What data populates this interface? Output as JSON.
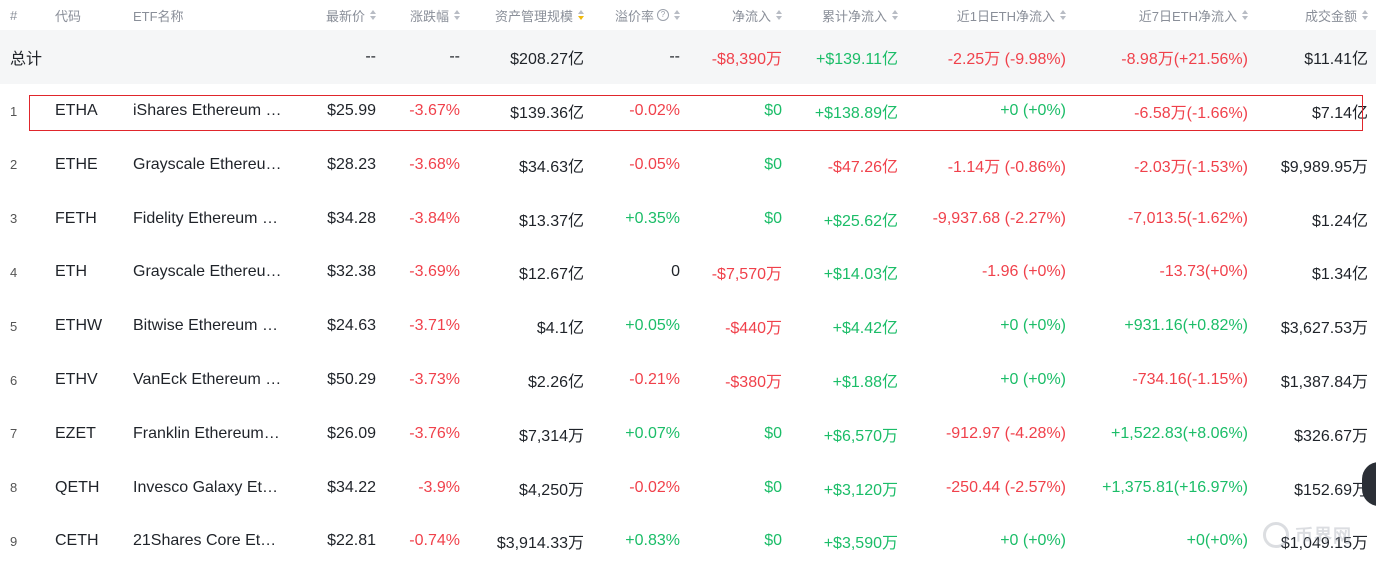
{
  "headers": {
    "idx": "#",
    "code": "代码",
    "name": "ETF名称",
    "price": "最新价",
    "change": "涨跌幅",
    "aum": "资产管理规模",
    "premium": "溢价率",
    "netflow": "净流入",
    "cumflow": "累计净流入",
    "eth1d": "近1日ETH净流入",
    "eth7d": "近7日ETH净流入",
    "volume": "成交金额"
  },
  "total": {
    "label": "总计",
    "price": "--",
    "change": "--",
    "aum": "$208.27亿",
    "premium": "--",
    "netflow": "-$8,390万",
    "cumflow": "+$139.11亿",
    "eth1d": "-2.25万 (-9.98%)",
    "eth7d": "-8.98万(+21.56%)",
    "volume": "$11.41亿"
  },
  "rows": [
    {
      "idx": "1",
      "code": "ETHA",
      "name": "iShares Ethereum …",
      "price": "$25.99",
      "change": "-3.67%",
      "aum": "$139.36亿",
      "premium": "-0.02%",
      "netflow": "$0",
      "cumflow": "+$138.89亿",
      "eth1d": "+0 (+0%)",
      "eth7d": "-6.58万(-1.66%)",
      "volume": "$7.14亿"
    },
    {
      "idx": "2",
      "code": "ETHE",
      "name": "Grayscale Ethereu…",
      "price": "$28.23",
      "change": "-3.68%",
      "aum": "$34.63亿",
      "premium": "-0.05%",
      "netflow": "$0",
      "cumflow": "-$47.26亿",
      "eth1d": "-1.14万 (-0.86%)",
      "eth7d": "-2.03万(-1.53%)",
      "volume": "$9,989.95万"
    },
    {
      "idx": "3",
      "code": "FETH",
      "name": "Fidelity Ethereum …",
      "price": "$34.28",
      "change": "-3.84%",
      "aum": "$13.37亿",
      "premium": "+0.35%",
      "netflow": "$0",
      "cumflow": "+$25.62亿",
      "eth1d": "-9,937.68 (-2.27%)",
      "eth7d": "-7,013.5(-1.62%)",
      "volume": "$1.24亿"
    },
    {
      "idx": "4",
      "code": "ETH",
      "name": "Grayscale Ethereu…",
      "price": "$32.38",
      "change": "-3.69%",
      "aum": "$12.67亿",
      "premium": "0",
      "netflow": "-$7,570万",
      "cumflow": "+$14.03亿",
      "eth1d": "-1.96 (+0%)",
      "eth7d": "-13.73(+0%)",
      "volume": "$1.34亿"
    },
    {
      "idx": "5",
      "code": "ETHW",
      "name": "Bitwise Ethereum …",
      "price": "$24.63",
      "change": "-3.71%",
      "aum": "$4.1亿",
      "premium": "+0.05%",
      "netflow": "-$440万",
      "cumflow": "+$4.42亿",
      "eth1d": "+0 (+0%)",
      "eth7d": "+931.16(+0.82%)",
      "volume": "$3,627.53万"
    },
    {
      "idx": "6",
      "code": "ETHV",
      "name": "VanEck Ethereum …",
      "price": "$50.29",
      "change": "-3.73%",
      "aum": "$2.26亿",
      "premium": "-0.21%",
      "netflow": "-$380万",
      "cumflow": "+$1.88亿",
      "eth1d": "+0 (+0%)",
      "eth7d": "-734.16(-1.15%)",
      "volume": "$1,387.84万"
    },
    {
      "idx": "7",
      "code": "EZET",
      "name": "Franklin Ethereum…",
      "price": "$26.09",
      "change": "-3.76%",
      "aum": "$7,314万",
      "premium": "+0.07%",
      "netflow": "$0",
      "cumflow": "+$6,570万",
      "eth1d": "-912.97 (-4.28%)",
      "eth7d": "+1,522.83(+8.06%)",
      "volume": "$326.67万"
    },
    {
      "idx": "8",
      "code": "QETH",
      "name": "Invesco Galaxy Et…",
      "price": "$34.22",
      "change": "-3.9%",
      "aum": "$4,250万",
      "premium": "-0.02%",
      "netflow": "$0",
      "cumflow": "+$3,120万",
      "eth1d": "-250.44 (-2.57%)",
      "eth7d": "+1,375.81(+16.97%)",
      "volume": "$152.69万"
    },
    {
      "idx": "9",
      "code": "CETH",
      "name": "21Shares Core Et…",
      "price": "$22.81",
      "change": "-0.74%",
      "aum": "$3,914.33万",
      "premium": "+0.83%",
      "netflow": "$0",
      "cumflow": "+$3,590万",
      "eth1d": "+0 (+0%)",
      "eth7d": "+0(+0%)",
      "volume": "$1,049.15万"
    }
  ],
  "watermark": "币界网",
  "colors": {
    "up": "#1bbd68",
    "down": "#f0414b",
    "highlight": "#e0262c",
    "sort_active": "#f0b90b"
  }
}
